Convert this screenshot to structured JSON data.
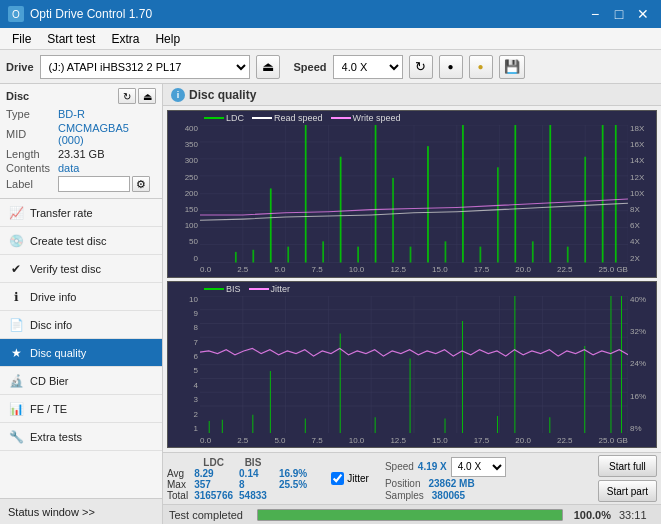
{
  "app": {
    "title": "Opti Drive Control 1.70",
    "icon": "O"
  },
  "titlebar": {
    "minimize_label": "−",
    "maximize_label": "□",
    "close_label": "✕"
  },
  "menubar": {
    "items": [
      "File",
      "Start test",
      "Extra",
      "Help"
    ]
  },
  "drive_toolbar": {
    "drive_label": "Drive",
    "drive_value": "(J:) ATAPI iHBS312  2 PL17",
    "eject_icon": "⏏",
    "speed_label": "Speed",
    "speed_value": "4.0 X",
    "refresh_icon": "↻",
    "icon1": "🔴",
    "icon2": "🟡",
    "save_icon": "💾"
  },
  "disc_panel": {
    "title": "Disc",
    "type_label": "Type",
    "type_value": "BD-R",
    "mid_label": "MID",
    "mid_value": "CMCMAGBA5 (000)",
    "length_label": "Length",
    "length_value": "23.31 GB",
    "contents_label": "Contents",
    "contents_value": "data",
    "label_label": "Label",
    "label_value": ""
  },
  "nav_items": [
    {
      "id": "transfer-rate",
      "label": "Transfer rate",
      "icon": "📈"
    },
    {
      "id": "create-test-disc",
      "label": "Create test disc",
      "icon": "💿"
    },
    {
      "id": "verify-test-disc",
      "label": "Verify test disc",
      "icon": "✔"
    },
    {
      "id": "drive-info",
      "label": "Drive info",
      "icon": "ℹ"
    },
    {
      "id": "disc-info",
      "label": "Disc info",
      "icon": "📄"
    },
    {
      "id": "disc-quality",
      "label": "Disc quality",
      "icon": "★",
      "active": true
    },
    {
      "id": "cd-bier",
      "label": "CD Bier",
      "icon": "🔬"
    },
    {
      "id": "fe-te",
      "label": "FE / TE",
      "icon": "📊"
    },
    {
      "id": "extra-tests",
      "label": "Extra tests",
      "icon": "🔧"
    }
  ],
  "status_window": {
    "label": "Status window >> "
  },
  "disc_quality": {
    "title": "Disc quality",
    "legend": {
      "ldc_label": "LDC",
      "read_speed_label": "Read speed",
      "write_speed_label": "Write speed",
      "bis_label": "BIS",
      "jitter_label": "Jitter"
    }
  },
  "chart1": {
    "y_left": [
      "400",
      "350",
      "300",
      "250",
      "200",
      "150",
      "100",
      "50",
      "0"
    ],
    "y_right": [
      "18X",
      "16X",
      "14X",
      "12X",
      "10X",
      "8X",
      "6X",
      "4X",
      "2X",
      ""
    ],
    "x": [
      "0.0",
      "2.5",
      "5.0",
      "7.5",
      "10.0",
      "12.5",
      "15.0",
      "17.5",
      "20.0",
      "22.5",
      "25.0 GB"
    ]
  },
  "chart2": {
    "y_left": [
      "10",
      "9",
      "8",
      "7",
      "6",
      "5",
      "4",
      "3",
      "2",
      "1"
    ],
    "y_right": [
      "40%",
      "32%",
      "24%",
      "16%",
      "8%",
      ""
    ],
    "x": [
      "0.0",
      "2.5",
      "5.0",
      "7.5",
      "10.0",
      "12.5",
      "15.0",
      "17.5",
      "20.0",
      "22.5",
      "25.0 GB"
    ]
  },
  "stats": {
    "headers": [
      "LDC",
      "BIS",
      "",
      "Jitter",
      "Speed",
      ""
    ],
    "avg_label": "Avg",
    "max_label": "Max",
    "total_label": "Total",
    "ldc_avg": "8.29",
    "ldc_max": "357",
    "ldc_total": "3165766",
    "bis_avg": "0.14",
    "bis_max": "8",
    "bis_total": "54833",
    "jitter_avg": "16.9%",
    "jitter_max": "25.5%",
    "jitter_total": "",
    "speed_avg": "4.19 X",
    "position_label": "Position",
    "position_value": "23862 MB",
    "samples_label": "Samples",
    "samples_value": "380065",
    "speed_select_value": "4.0 X",
    "start_full_label": "Start full",
    "start_part_label": "Start part"
  },
  "progress": {
    "status_label": "Test completed",
    "percent": 100,
    "percent_text": "100.0%",
    "time": "33:11"
  }
}
